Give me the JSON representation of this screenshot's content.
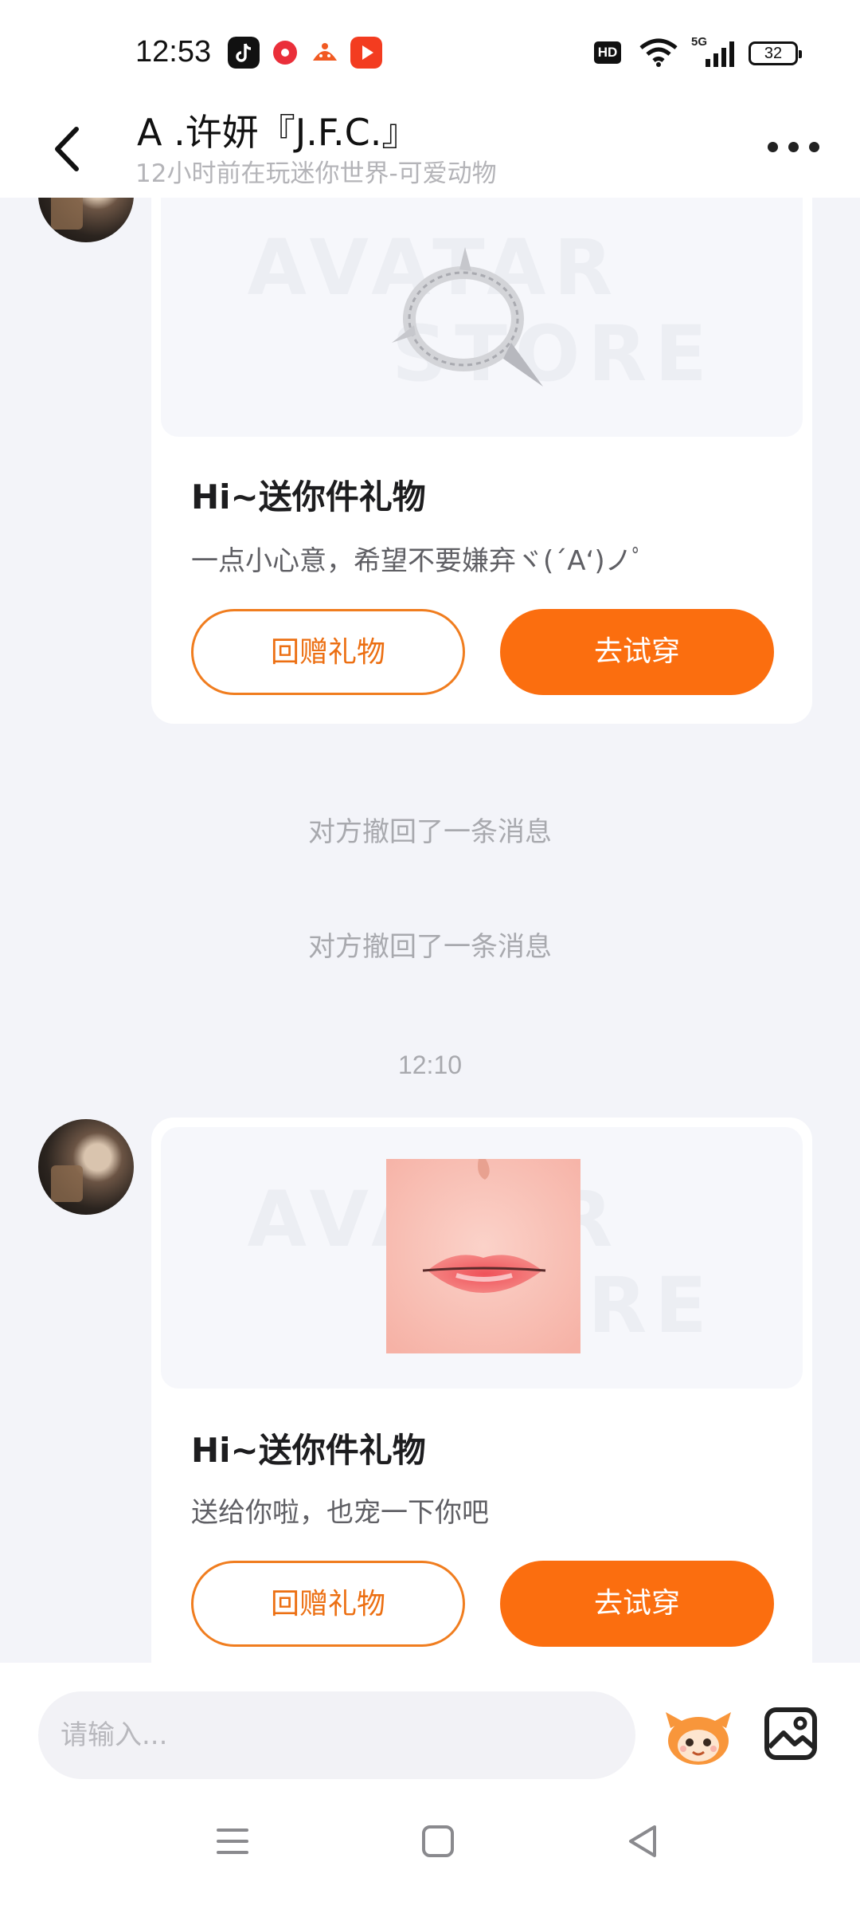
{
  "status_bar": {
    "time": "12:53",
    "hd": "HD",
    "network": "5G",
    "battery": "32",
    "app_icons": [
      "tiktok-icon",
      "red-app-icon",
      "orange-app-icon",
      "video-app-icon"
    ]
  },
  "header": {
    "title": "A .许妍『J.F.C.』",
    "subtitle": "12小时前在玩迷你世界-可爱动物"
  },
  "messages": {
    "gift1": {
      "watermark_top": "AVATAR",
      "watermark_bottom": "STORE",
      "title": "Hi~送你件礼物",
      "desc": "一点小心意，希望不要嫌弃ヾ(´A‘)ノﾟ",
      "return_gift_label": "回赠礼物",
      "try_on_label": "去试穿"
    },
    "recall1": "对方撤回了一条消息",
    "recall2": "对方撤回了一条消息",
    "timestamp": "12:10",
    "gift2": {
      "watermark_top": "AVATAR",
      "watermark_bottom": "STORE",
      "title": "Hi~送你件礼物",
      "desc": "送给你啦，也宠一下你吧",
      "return_gift_label": "回赠礼物",
      "try_on_label": "去试穿"
    }
  },
  "input": {
    "placeholder": "请输入..."
  },
  "colors": {
    "accent": "#fb6e0f",
    "background": "#f3f4f9"
  }
}
